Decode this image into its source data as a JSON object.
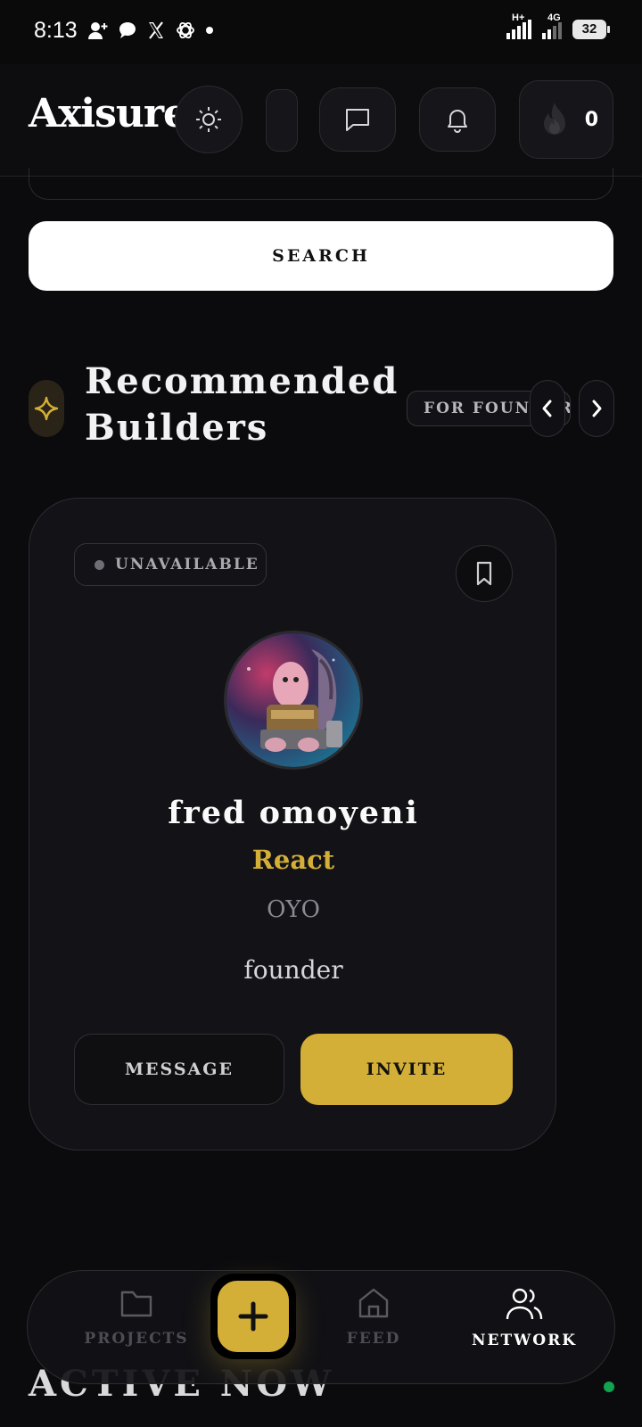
{
  "status_bar": {
    "time": "8:13",
    "notification_icons": [
      "person-add-icon",
      "chat-bubble-icon",
      "x-logo-icon",
      "openai-icon",
      "dot-icon"
    ],
    "network_labels": [
      "H+",
      "4G"
    ],
    "battery": "32"
  },
  "header": {
    "logo": "Axisure",
    "streak_count": "0",
    "icons": [
      "sun-icon",
      "message-square-icon",
      "bell-icon",
      "flame-icon"
    ]
  },
  "search": {
    "button_label": "SEARCH"
  },
  "section": {
    "title_line1": "Recommended",
    "title_line2": "Builders",
    "filter_label": "FOR FOUNDERS",
    "accent_color": "#d4af37"
  },
  "profile_card": {
    "availability": "UNAVAILABLE",
    "name": "fred omoyeni",
    "skill": "React",
    "location": "OYO",
    "role": "founder",
    "message_label": "MESSAGE",
    "invite_label": "INVITE"
  },
  "active_now": {
    "title": "ACTIVE NOW"
  },
  "bottom_nav": {
    "items": [
      {
        "label": "PROJECTS",
        "icon": "folder-icon",
        "active": false
      },
      {
        "label": "FEED",
        "icon": "home-icon",
        "active": false
      },
      {
        "label": "NETWORK",
        "icon": "users-icon",
        "active": true
      }
    ],
    "fab_icon": "plus-icon"
  }
}
